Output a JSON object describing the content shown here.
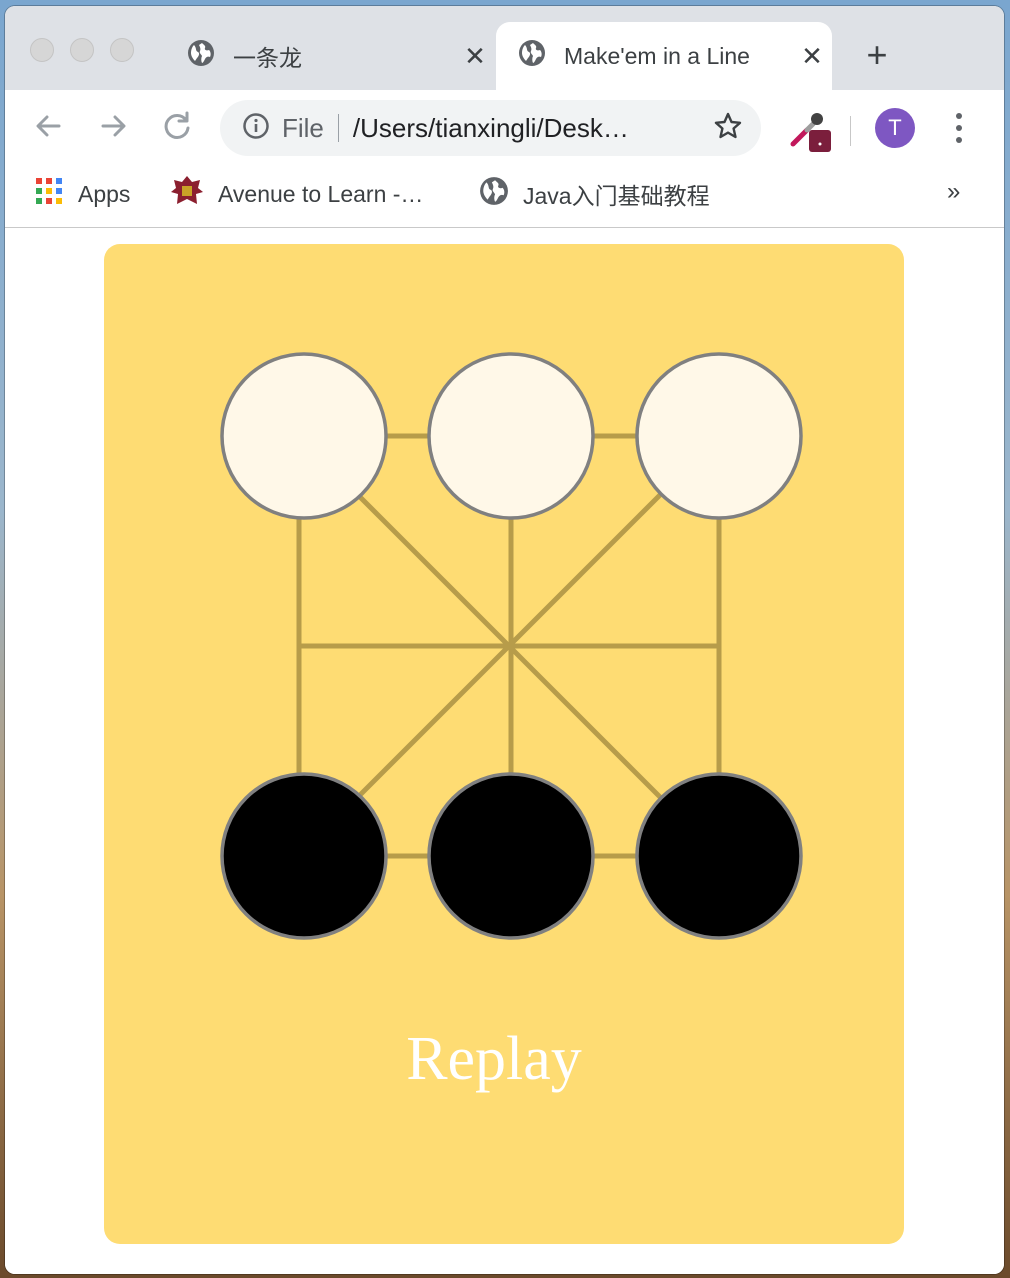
{
  "browser": {
    "tabs": [
      {
        "title": "一条龙",
        "active": false
      },
      {
        "title": "Make'em in a Line",
        "active": true
      }
    ],
    "close_glyph": "✕",
    "new_tab_glyph": "+",
    "omnibox": {
      "scheme": "File",
      "url": "/Users/tianxingli/Desk…"
    },
    "avatar_initial": "T",
    "bookmarks": [
      {
        "label": "Apps",
        "icon": "apps-grid-icon"
      },
      {
        "label": "Avenue to Learn -…",
        "icon": "crest-icon"
      },
      {
        "label": "Java入门基础教程",
        "icon": "globe-icon"
      }
    ],
    "bookmarks_more": "»"
  },
  "game": {
    "board_color": "#fedc73",
    "line_color": "#b79c4a",
    "piece_border": "#808080",
    "colors": {
      "white": "#fff8e8",
      "black": "#000000"
    },
    "pieces": [
      {
        "position": "top-left",
        "color": "white"
      },
      {
        "position": "top-center",
        "color": "white"
      },
      {
        "position": "top-right",
        "color": "white"
      },
      {
        "position": "bottom-left",
        "color": "black"
      },
      {
        "position": "bottom-center",
        "color": "black"
      },
      {
        "position": "bottom-right",
        "color": "black"
      }
    ],
    "replay_label": "Replay"
  }
}
